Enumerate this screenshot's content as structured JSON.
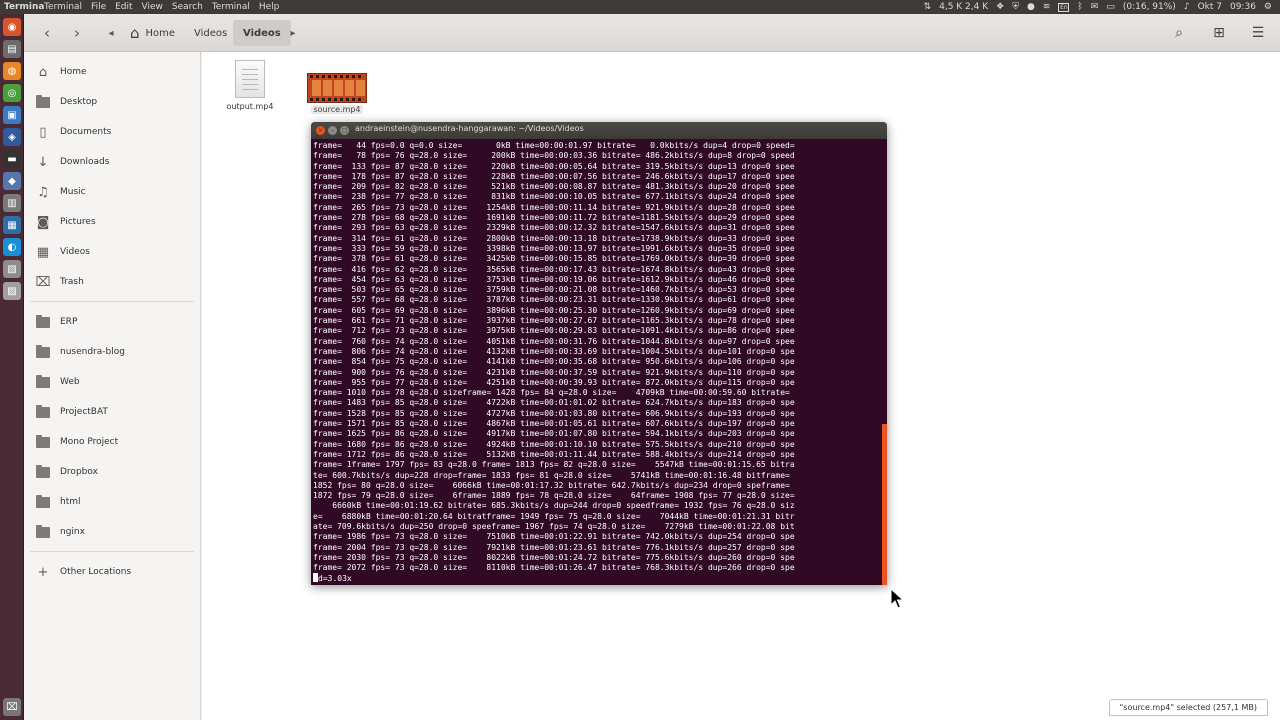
{
  "topbar": {
    "app_name": "Termina",
    "menus": [
      "Terminal",
      "File",
      "Edit",
      "View",
      "Search",
      "Terminal",
      "Help"
    ],
    "network": "4,5 K 2,4 K",
    "lang": "En",
    "battery": "(0:16, 91%)",
    "date": "Okt 7",
    "time": "09:36"
  },
  "nav": {
    "breadcrumbs": [
      "Home",
      "Videos",
      "Videos"
    ]
  },
  "sidebar": {
    "places": [
      "Home",
      "Desktop",
      "Documents",
      "Downloads",
      "Music",
      "Pictures",
      "Videos",
      "Trash"
    ],
    "bookmarks": [
      "ERP",
      "nusendra-blog",
      "Web",
      "ProjectBAT",
      "Mono Project",
      "Dropbox",
      "html",
      "nginx"
    ],
    "other_locations": "Other Locations"
  },
  "files": [
    {
      "name": "output.mp4",
      "type": "document"
    },
    {
      "name": "source.mp4",
      "type": "video"
    }
  ],
  "terminal": {
    "title": "andraeinstein@nusendra-hanggarawan: ~/Videos/Videos",
    "lines": [
      "frame=   44 fps=0.0 q=0.0 size=       0kB time=00:00:01.97 bitrate=   0.0kbits/s dup=4 drop=0 speed=",
      "frame=   78 fps= 76 q=28.0 size=     200kB time=00:00:03.36 bitrate= 486.2kbits/s dup=8 drop=0 speed",
      "frame=  133 fps= 87 q=28.0 size=     220kB time=00:00:05.64 bitrate= 319.5kbits/s dup=13 drop=0 spee",
      "frame=  178 fps= 87 q=28.0 size=     228kB time=00:00:07.56 bitrate= 246.6kbits/s dup=17 drop=0 spee",
      "frame=  209 fps= 82 q=28.0 size=     521kB time=00:00:08.87 bitrate= 481.3kbits/s dup=20 drop=0 spee",
      "frame=  238 fps= 77 q=28.0 size=     831kB time=00:00:10.05 bitrate= 677.1kbits/s dup=24 drop=0 spee",
      "frame=  265 fps= 73 q=28.0 size=    1254kB time=00:00:11.14 bitrate= 921.9kbits/s dup=28 drop=0 spee",
      "frame=  278 fps= 68 q=28.0 size=    1691kB time=00:00:11.72 bitrate=1181.5kbits/s dup=29 drop=0 spee",
      "frame=  293 fps= 63 q=28.0 size=    2329kB time=00:00:12.32 bitrate=1547.6kbits/s dup=31 drop=0 spee",
      "frame=  314 fps= 61 q=28.0 size=    2800kB time=00:00:13.18 bitrate=1738.9kbits/s dup=33 drop=0 spee",
      "frame=  333 fps= 59 q=28.0 size=    3398kB time=00:00:13.97 bitrate=1991.6kbits/s dup=35 drop=0 spee",
      "frame=  378 fps= 61 q=28.0 size=    3425kB time=00:00:15.85 bitrate=1769.0kbits/s dup=39 drop=0 spee",
      "frame=  416 fps= 62 q=28.0 size=    3565kB time=00:00:17.43 bitrate=1674.8kbits/s dup=43 drop=0 spee",
      "frame=  454 fps= 63 q=28.0 size=    3753kB time=00:00:19.06 bitrate=1612.9kbits/s dup=46 drop=0 spee",
      "frame=  503 fps= 65 q=28.0 size=    3759kB time=00:00:21.08 bitrate=1460.7kbits/s dup=53 drop=0 spee",
      "frame=  557 fps= 68 q=28.0 size=    3787kB time=00:00:23.31 bitrate=1330.9kbits/s dup=61 drop=0 spee",
      "frame=  605 fps= 69 q=28.0 size=    3896kB time=00:00:25.30 bitrate=1260.9kbits/s dup=69 drop=0 spee",
      "frame=  661 fps= 71 q=28.0 size=    3937kB time=00:00:27.67 bitrate=1165.3kbits/s dup=78 drop=0 spee",
      "frame=  712 fps= 73 q=28.0 size=    3975kB time=00:00:29.83 bitrate=1091.4kbits/s dup=86 drop=0 spee",
      "frame=  760 fps= 74 q=28.0 size=    4051kB time=00:00:31.76 bitrate=1044.8kbits/s dup=97 drop=0 spee",
      "frame=  806 fps= 74 q=28.0 size=    4132kB time=00:00:33.69 bitrate=1004.5kbits/s dup=101 drop=0 spe",
      "frame=  854 fps= 75 q=28.0 size=    4141kB time=00:00:35.68 bitrate= 950.6kbits/s dup=106 drop=0 spe",
      "frame=  900 fps= 76 q=28.0 size=    4231kB time=00:00:37.59 bitrate= 921.9kbits/s dup=110 drop=0 spe",
      "frame=  955 fps= 77 q=28.0 size=    4251kB time=00:00:39.93 bitrate= 872.0kbits/s dup=115 drop=0 spe",
      "frame= 1010 fps= 78 q=28.0 sizeframe= 1428 fps= 84 q=28.0 size=    4709kB time=00:00:59.60 bitrate=",
      "frame= 1483 fps= 85 q=28.0 size=    4722kB time=00:01:01.02 bitrate= 624.7kbits/s dup=183 drop=0 spe",
      "frame= 1528 fps= 85 q=28.0 size=    4727kB time=00:01:03.80 bitrate= 606.9kbits/s dup=193 drop=0 spe",
      "frame= 1571 fps= 85 q=28.0 size=    4867kB time=00:01:05.61 bitrate= 607.6kbits/s dup=197 drop=0 spe",
      "frame= 1625 fps= 86 q=28.0 size=    4917kB time=00:01:07.80 bitrate= 594.1kbits/s dup=203 drop=0 spe",
      "frame= 1680 fps= 86 q=28.0 size=    4924kB time=00:01:10.10 bitrate= 575.5kbits/s dup=210 drop=0 spe",
      "frame= 1712 fps= 86 q=28.0 size=    5132kB time=00:01:11.44 bitrate= 588.4kbits/s dup=214 drop=0 spe",
      "frame= 1frame= 1797 fps= 83 q=28.0 frame= 1813 fps= 82 q=28.0 size=    5547kB time=00:01:15.65 bitra",
      "te= 600.7kbits/s dup=228 drop=frame= 1833 fps= 81 q=28.0 size=    5741kB time=00:01:16.48 bitframe=",
      "1852 fps= 80 q=28.0 size=    6066kB time=00:01:17.32 bitrate= 642.7kbits/s dup=234 drop=0 speframe=",
      "1872 fps= 79 q=28.0 size=    6frame= 1889 fps= 78 q=28.0 size=    64frame= 1908 fps= 77 q=28.0 size=",
      "    6660kB time=00:01:19.62 bitrate= 685.3kbits/s dup=244 drop=0 speedframe= 1932 fps= 76 q=28.0 siz",
      "e=    6880kB time=00:01:20.64 bitratframe= 1949 fps= 75 q=28.0 size=    7044kB time=00:01:21.31 bitr",
      "ate= 709.6kbits/s dup=250 drop=0 speeframe= 1967 fps= 74 q=28.0 size=    7279kB time=00:01:22.08 bit",
      "frame= 1986 fps= 73 q=28.0 size=    7510kB time=00:01:22.91 bitrate= 742.0kbits/s dup=254 drop=0 spe",
      "frame= 2004 fps= 73 q=28.0 size=    7921kB time=00:01:23.61 bitrate= 776.1kbits/s dup=257 drop=0 spe",
      "frame= 2030 fps= 73 q=28.0 size=    8022kB time=00:01:24.72 bitrate= 775.6kbits/s dup=260 drop=0 spe",
      "frame= 2072 fps= 73 q=28.0 size=    8110kB time=00:01:26.47 bitrate= 768.3kbits/s dup=266 drop=0 spe"
    ],
    "last_line": "d=3.03x"
  },
  "status": "\"source.mp4\" selected  (257,1 MB)",
  "colors": {
    "terminal_bg": "#300a24",
    "launcher_bg": "#4a2a35",
    "accent": "#e95420"
  }
}
